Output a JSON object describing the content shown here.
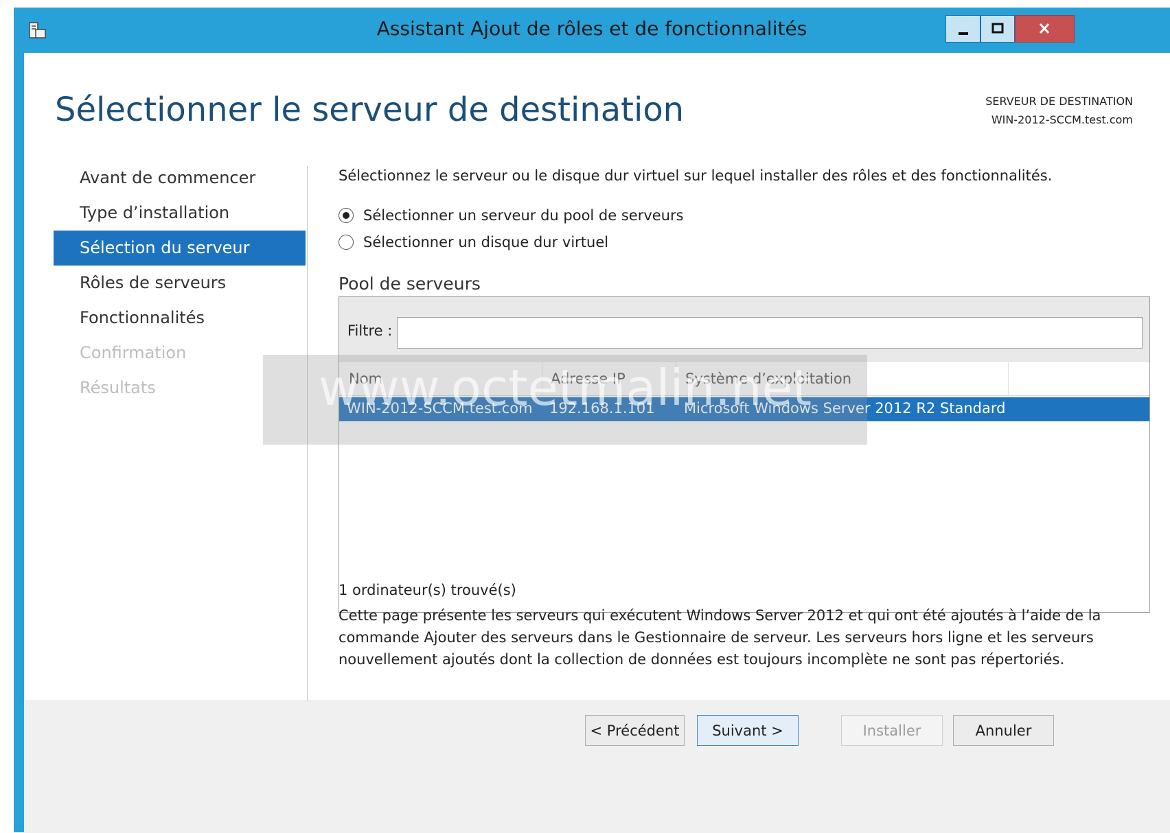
{
  "window": {
    "title": "Assistant Ajout de rôles et de fonctionnalités",
    "controls": {
      "minimize": "—",
      "maximize": "□",
      "close": "x"
    }
  },
  "page": {
    "title": "Sélectionner le serveur de destination",
    "destination_label": "SERVEUR DE DESTINATION",
    "destination_server": "WIN-2012-SCCM.test.com"
  },
  "nav": {
    "items": [
      {
        "label": "Avant de commencer",
        "state": "normal"
      },
      {
        "label": "Type d’installation",
        "state": "normal"
      },
      {
        "label": "Sélection du serveur",
        "state": "active"
      },
      {
        "label": "Rôles de serveurs",
        "state": "normal"
      },
      {
        "label": "Fonctionnalités",
        "state": "normal"
      },
      {
        "label": "Confirmation",
        "state": "disabled"
      },
      {
        "label": "Résultats",
        "state": "disabled"
      }
    ]
  },
  "content": {
    "description": "Sélectionnez le serveur ou le disque dur virtuel sur lequel installer des rôles et des fonctionnalités.",
    "options": [
      {
        "label": "Sélectionner un serveur du pool de serveurs",
        "checked": true
      },
      {
        "label": "Sélectionner un disque dur virtuel",
        "checked": false
      }
    ],
    "pool_title": "Pool de serveurs",
    "filter_label": "Filtre :",
    "filter_value": "",
    "columns": [
      "Nom",
      "Adresse IP",
      "Système d’exploitation"
    ],
    "rows": [
      [
        "WIN-2012-SCCM.test.com",
        "192.168.1.101",
        "Microsoft Windows Server 2012 R2 Standard"
      ]
    ],
    "count_text": "1 ordinateur(s) trouvé(s)",
    "info_text": "Cette page présente les serveurs qui exécutent Windows Server 2012 et qui ont été ajoutés à l’aide de la commande Ajouter des serveurs dans le Gestionnaire de serveur. Les serveurs hors ligne et les serveurs nouvellement ajoutés dont la collection de données est toujours incomplète ne sont pas répertoriés."
  },
  "watermark": "www.octetmalin.net",
  "buttons": {
    "previous": "< Précédent",
    "next": "Suivant >",
    "install": "Installer",
    "cancel": "Annuler"
  },
  "colors": {
    "window_frame": "#28a0d8",
    "selection": "#1e73be",
    "title_text": "#1c4f78"
  }
}
